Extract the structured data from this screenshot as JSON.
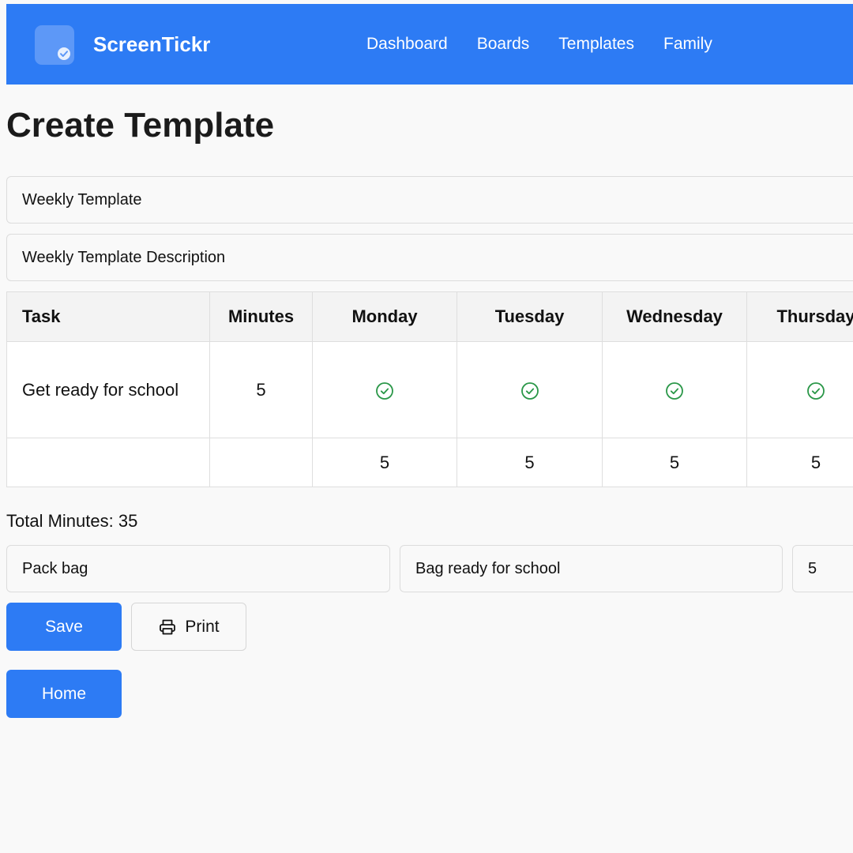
{
  "app": {
    "brand": "ScreenTickr"
  },
  "nav": {
    "links": [
      "Dashboard",
      "Boards",
      "Templates",
      "Family"
    ]
  },
  "page": {
    "title": "Create Template"
  },
  "form": {
    "template_name": "Weekly Template",
    "template_description": "Weekly Template Description"
  },
  "table": {
    "headers": [
      "Task",
      "Minutes",
      "Monday",
      "Tuesday",
      "Wednesday",
      "Thursday"
    ],
    "rows": [
      {
        "task": "Get ready for school",
        "minutes": "5",
        "days": [
          true,
          true,
          true,
          true
        ]
      }
    ],
    "day_totals": [
      "5",
      "5",
      "5",
      "5"
    ]
  },
  "summary": {
    "total_minutes_text": "Total Minutes: 35"
  },
  "new_task": {
    "name": "Pack bag",
    "description": "Bag ready for school",
    "minutes": "5"
  },
  "buttons": {
    "save": "Save",
    "print": "Print",
    "home": "Home"
  },
  "colors": {
    "accent": "#2d7bf4",
    "check": "#2a9748",
    "background": "#f9f9f9"
  },
  "icons": {
    "logo": "check-badge-icon",
    "day_check": "check-circle-icon",
    "print": "printer-icon"
  }
}
